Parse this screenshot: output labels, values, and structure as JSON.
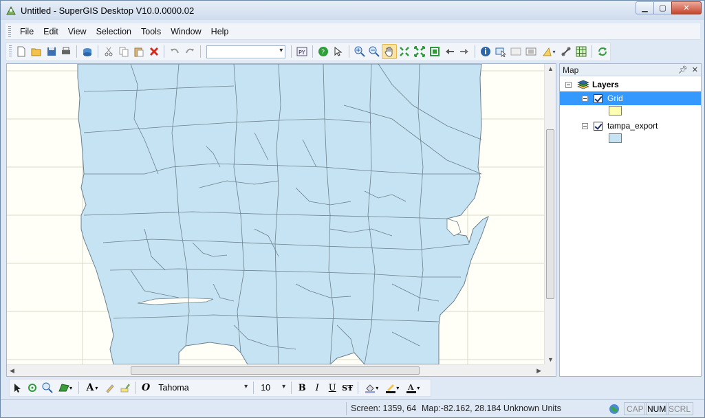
{
  "window": {
    "title": "Untitled - SuperGIS Desktop V10.0.0000.02"
  },
  "menu": [
    "File",
    "Edit",
    "View",
    "Selection",
    "Tools",
    "Window",
    "Help"
  ],
  "toolbar": {
    "scale_value": "",
    "buttons": [
      "new-icon",
      "open-icon",
      "save-icon",
      "print-icon",
      "add-data-icon",
      "cut-icon",
      "copy-icon",
      "paste-icon",
      "delete-icon",
      "undo-icon",
      "redo-icon",
      "python-icon",
      "help-icon",
      "whats-this-icon",
      "zoom-in-icon",
      "zoom-out-icon",
      "pan-icon",
      "fixed-zoom-in-icon",
      "fixed-zoom-out-icon",
      "full-extent-icon",
      "back-icon",
      "forward-icon",
      "identify-icon",
      "select-features-icon",
      "clear-selection-icon",
      "attribute-table-icon",
      "measure-icon",
      "hyperlink-icon",
      "grid-icon",
      "refresh-icon"
    ],
    "active_tool": "pan-icon"
  },
  "panel": {
    "title": "Map",
    "root_label": "Layers",
    "layers": [
      {
        "name": "Grid",
        "checked": true,
        "selected": true,
        "swatch_color": "#ffffb0"
      },
      {
        "name": "tampa_export",
        "checked": true,
        "selected": false,
        "swatch_color": "#c5e3f2"
      }
    ]
  },
  "drawbar": {
    "font_name": "Tahoma",
    "font_size": "10",
    "bold": "B",
    "italic": "I",
    "underline": "U",
    "strike": "SŦ",
    "text_tool": "A"
  },
  "status": {
    "screen": "Screen: 1359, 64",
    "map": "Map:-82.162, 28.184 Unknown Units",
    "cap": "CAP",
    "num": "NUM",
    "scrl": "SCRL"
  },
  "colors": {
    "map_fill": "#c5e3f2",
    "map_stroke": "#6b7f8c",
    "selection": "#3399ff"
  }
}
